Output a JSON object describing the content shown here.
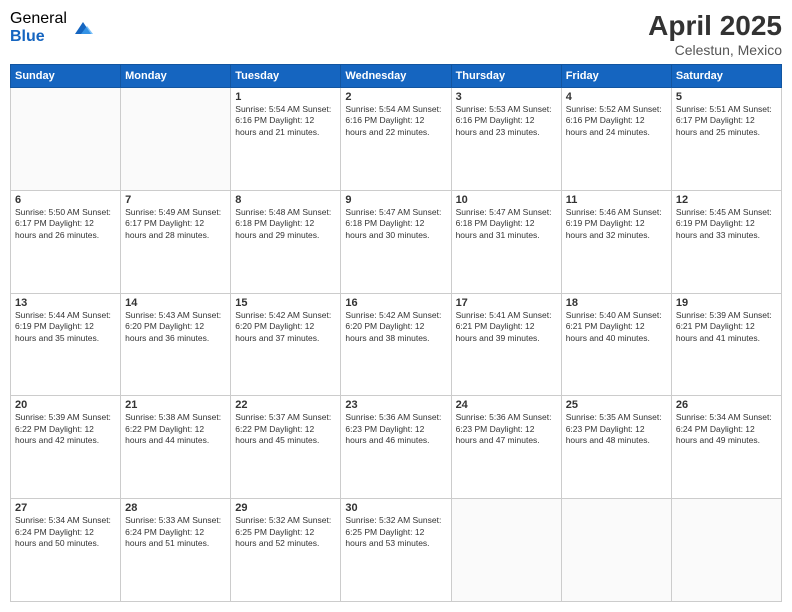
{
  "header": {
    "logo_general": "General",
    "logo_blue": "Blue",
    "title": "April 2025",
    "subtitle": "Celestun, Mexico"
  },
  "days_of_week": [
    "Sunday",
    "Monday",
    "Tuesday",
    "Wednesday",
    "Thursday",
    "Friday",
    "Saturday"
  ],
  "weeks": [
    [
      {
        "day": "",
        "info": ""
      },
      {
        "day": "",
        "info": ""
      },
      {
        "day": "1",
        "info": "Sunrise: 5:54 AM\nSunset: 6:16 PM\nDaylight: 12 hours\nand 21 minutes."
      },
      {
        "day": "2",
        "info": "Sunrise: 5:54 AM\nSunset: 6:16 PM\nDaylight: 12 hours\nand 22 minutes."
      },
      {
        "day": "3",
        "info": "Sunrise: 5:53 AM\nSunset: 6:16 PM\nDaylight: 12 hours\nand 23 minutes."
      },
      {
        "day": "4",
        "info": "Sunrise: 5:52 AM\nSunset: 6:16 PM\nDaylight: 12 hours\nand 24 minutes."
      },
      {
        "day": "5",
        "info": "Sunrise: 5:51 AM\nSunset: 6:17 PM\nDaylight: 12 hours\nand 25 minutes."
      }
    ],
    [
      {
        "day": "6",
        "info": "Sunrise: 5:50 AM\nSunset: 6:17 PM\nDaylight: 12 hours\nand 26 minutes."
      },
      {
        "day": "7",
        "info": "Sunrise: 5:49 AM\nSunset: 6:17 PM\nDaylight: 12 hours\nand 28 minutes."
      },
      {
        "day": "8",
        "info": "Sunrise: 5:48 AM\nSunset: 6:18 PM\nDaylight: 12 hours\nand 29 minutes."
      },
      {
        "day": "9",
        "info": "Sunrise: 5:47 AM\nSunset: 6:18 PM\nDaylight: 12 hours\nand 30 minutes."
      },
      {
        "day": "10",
        "info": "Sunrise: 5:47 AM\nSunset: 6:18 PM\nDaylight: 12 hours\nand 31 minutes."
      },
      {
        "day": "11",
        "info": "Sunrise: 5:46 AM\nSunset: 6:19 PM\nDaylight: 12 hours\nand 32 minutes."
      },
      {
        "day": "12",
        "info": "Sunrise: 5:45 AM\nSunset: 6:19 PM\nDaylight: 12 hours\nand 33 minutes."
      }
    ],
    [
      {
        "day": "13",
        "info": "Sunrise: 5:44 AM\nSunset: 6:19 PM\nDaylight: 12 hours\nand 35 minutes."
      },
      {
        "day": "14",
        "info": "Sunrise: 5:43 AM\nSunset: 6:20 PM\nDaylight: 12 hours\nand 36 minutes."
      },
      {
        "day": "15",
        "info": "Sunrise: 5:42 AM\nSunset: 6:20 PM\nDaylight: 12 hours\nand 37 minutes."
      },
      {
        "day": "16",
        "info": "Sunrise: 5:42 AM\nSunset: 6:20 PM\nDaylight: 12 hours\nand 38 minutes."
      },
      {
        "day": "17",
        "info": "Sunrise: 5:41 AM\nSunset: 6:21 PM\nDaylight: 12 hours\nand 39 minutes."
      },
      {
        "day": "18",
        "info": "Sunrise: 5:40 AM\nSunset: 6:21 PM\nDaylight: 12 hours\nand 40 minutes."
      },
      {
        "day": "19",
        "info": "Sunrise: 5:39 AM\nSunset: 6:21 PM\nDaylight: 12 hours\nand 41 minutes."
      }
    ],
    [
      {
        "day": "20",
        "info": "Sunrise: 5:39 AM\nSunset: 6:22 PM\nDaylight: 12 hours\nand 42 minutes."
      },
      {
        "day": "21",
        "info": "Sunrise: 5:38 AM\nSunset: 6:22 PM\nDaylight: 12 hours\nand 44 minutes."
      },
      {
        "day": "22",
        "info": "Sunrise: 5:37 AM\nSunset: 6:22 PM\nDaylight: 12 hours\nand 45 minutes."
      },
      {
        "day": "23",
        "info": "Sunrise: 5:36 AM\nSunset: 6:23 PM\nDaylight: 12 hours\nand 46 minutes."
      },
      {
        "day": "24",
        "info": "Sunrise: 5:36 AM\nSunset: 6:23 PM\nDaylight: 12 hours\nand 47 minutes."
      },
      {
        "day": "25",
        "info": "Sunrise: 5:35 AM\nSunset: 6:23 PM\nDaylight: 12 hours\nand 48 minutes."
      },
      {
        "day": "26",
        "info": "Sunrise: 5:34 AM\nSunset: 6:24 PM\nDaylight: 12 hours\nand 49 minutes."
      }
    ],
    [
      {
        "day": "27",
        "info": "Sunrise: 5:34 AM\nSunset: 6:24 PM\nDaylight: 12 hours\nand 50 minutes."
      },
      {
        "day": "28",
        "info": "Sunrise: 5:33 AM\nSunset: 6:24 PM\nDaylight: 12 hours\nand 51 minutes."
      },
      {
        "day": "29",
        "info": "Sunrise: 5:32 AM\nSunset: 6:25 PM\nDaylight: 12 hours\nand 52 minutes."
      },
      {
        "day": "30",
        "info": "Sunrise: 5:32 AM\nSunset: 6:25 PM\nDaylight: 12 hours\nand 53 minutes."
      },
      {
        "day": "",
        "info": ""
      },
      {
        "day": "",
        "info": ""
      },
      {
        "day": "",
        "info": ""
      }
    ]
  ]
}
